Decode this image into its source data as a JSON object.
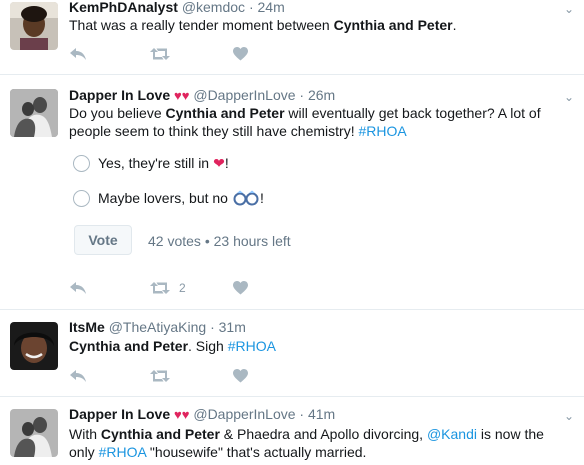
{
  "tweets": [
    {
      "name": "KemPhDAnalyst",
      "handle": "@kemdoc",
      "time": "24m",
      "text_parts": [
        "That was a really tender moment between ",
        "Cynthia and Peter",
        "."
      ]
    },
    {
      "name": "Dapper In Love",
      "handle": "@DapperInLove",
      "time": "26m",
      "text_a": "Do you believe ",
      "text_b": "Cynthia and Peter",
      "text_c": " will eventually get back together? A lot of people seem to think they still have chemistry!",
      "hashtag": "#RHOA",
      "poll": {
        "option1": "Yes, they're still in",
        "option1_suffix": "!",
        "option2": "Maybe lovers, but no",
        "option2_suffix": "!",
        "vote_label": "Vote",
        "meta": "42 votes • 23 hours left"
      },
      "retweet_count": "2"
    },
    {
      "name": "ItsMe",
      "handle": "@TheAtiyaKing",
      "time": "31m",
      "text_b": "Cynthia and Peter",
      "text_c": ". Sigh ",
      "hashtag": "#RHOA"
    },
    {
      "name": "Dapper In Love",
      "handle": "@DapperInLove",
      "time": "41m",
      "text_a": "With ",
      "text_b": "Cynthia and Peter",
      "text_c": " & Phaedra and Apollo divorcing, ",
      "mention": "@Kandi",
      "text_d": " is now the only ",
      "hashtag": "#RHOA",
      "text_e": " \"housewife\" that's actually married."
    }
  ],
  "separator": "·",
  "colors": {
    "link": "#1b95e0",
    "muted": "#657786",
    "heart": "#e0245e"
  }
}
